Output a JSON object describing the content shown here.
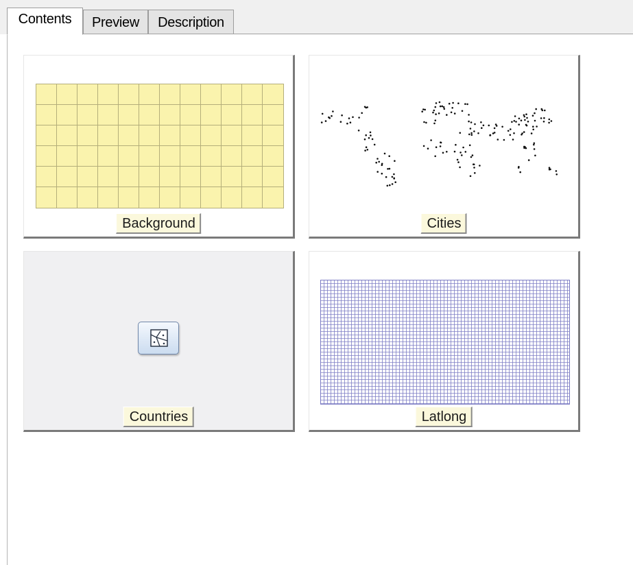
{
  "tabs": [
    {
      "label": "Contents",
      "active": true
    },
    {
      "label": "Preview",
      "active": false
    },
    {
      "label": "Description",
      "active": false
    }
  ],
  "items": [
    {
      "label": "Background",
      "icon": "grid-thumbnail-yellow"
    },
    {
      "label": "Cities",
      "icon": "point-map-thumbnail"
    },
    {
      "label": "Countries",
      "icon": "feature-dataset-icon"
    },
    {
      "label": "Latlong",
      "icon": "graticule-thumbnail-blue"
    }
  ],
  "colors": {
    "background_fill": "#faf3ad",
    "background_grid": "#b4ae7a",
    "latlong_grid": "#7c7cc4",
    "city_points": "#111111",
    "label_fill": "#fbf8dc"
  }
}
